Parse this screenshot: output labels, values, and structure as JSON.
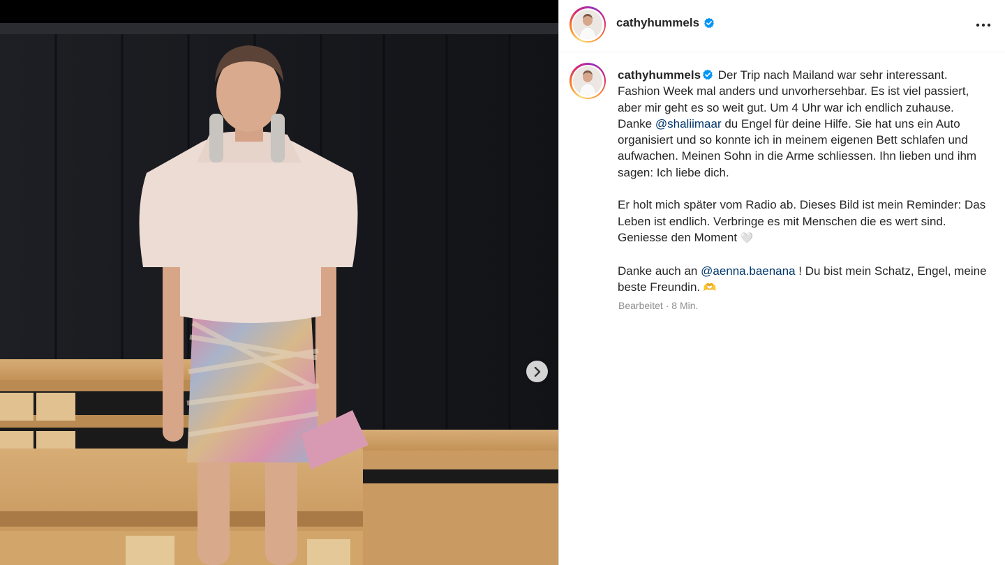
{
  "post": {
    "username": "cathyhummels",
    "caption": {
      "line_intro": "Der Trip nach Mailand war sehr interessant. Fashion Week mal anders und unvorhersehbar. Es ist viel passiert, aber mir geht es so weit gut. Um 4 Uhr war ich endlich zuhause. Danke",
      "mention_1": "@shaliimaar",
      "line_intro_cont": "du Engel für deine Hilfe. Sie hat uns ein Auto organisiert und so konnte ich in meinem eigenen Bett schlafen und aufwachen. Meinen Sohn in die Arme schliessen. Ihn lieben und ihm sagen: Ich liebe dich.",
      "paragraph_2": "Er holt mich später vom Radio ab. Dieses Bild ist mein Reminder: Das Leben ist endlich. Verbringe es mit Menschen die es wert sind. Geniesse den Moment",
      "heart_emoji": "🤍",
      "paragraph_3_start": "Danke auch an",
      "mention_2": "@aenna.baenana",
      "paragraph_3_end": "! Du bist mein Schatz, Engel, meine beste Freundin.",
      "hands_emoji": "🫶"
    },
    "edited_label": "Bearbeitet · 8 Min."
  },
  "icons": {
    "verified": "verified-badge-icon",
    "more": "more-options-icon",
    "next": "chevron-right-icon"
  },
  "colors": {
    "verified_blue": "#0095f6",
    "mention_blue": "#00376b",
    "meta_gray": "#8e8e8e"
  }
}
